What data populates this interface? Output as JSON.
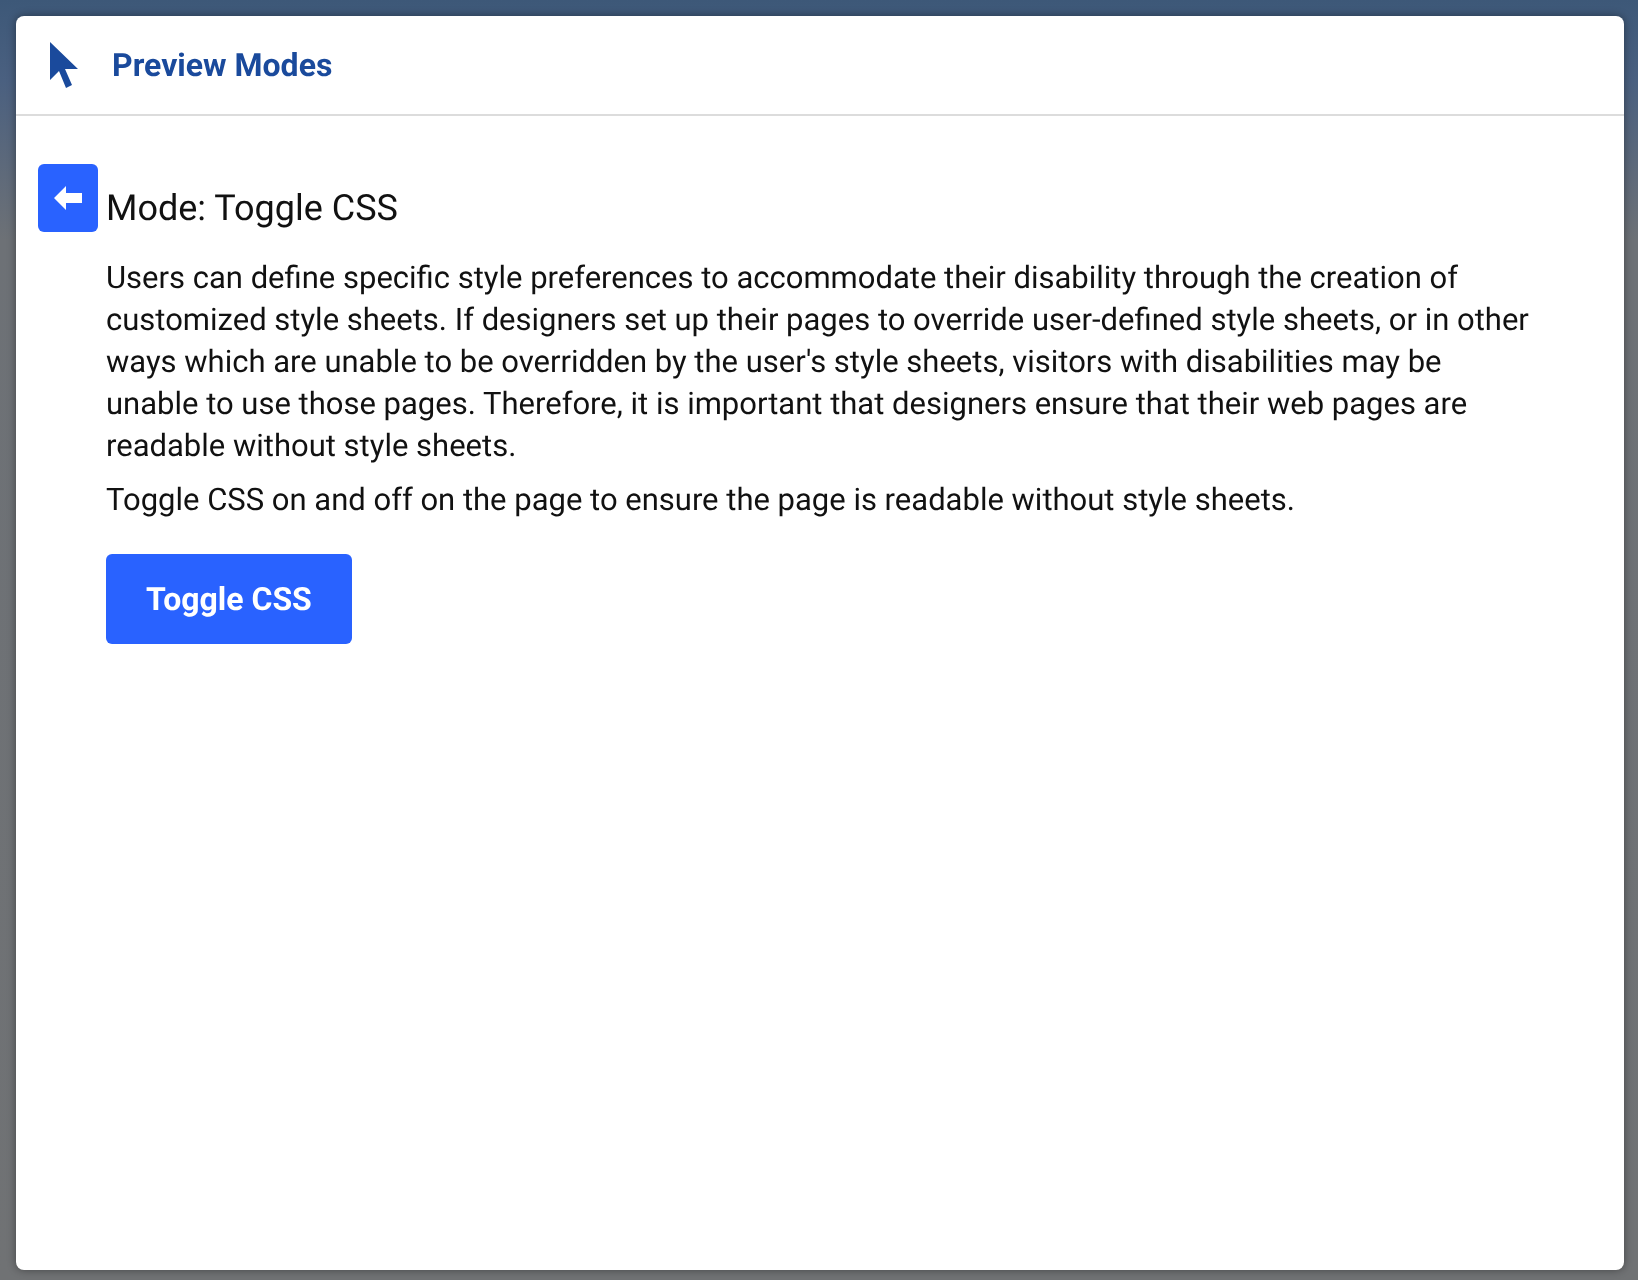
{
  "dialog": {
    "title": "Preview Modes"
  },
  "mode": {
    "title": "Mode: Toggle CSS",
    "paragraphs": [
      "Users can define specific style preferences to accommodate their disability through the creation of customized style sheets. If designers set up their pages to override user-defined style sheets, or in other ways which are unable to be overridden by the user's style sheets, visitors with disabilities may be unable to use those pages. Therefore, it is important that designers ensure that their web pages are readable without style sheets.",
      "Toggle CSS on and off on the page to ensure the page is readable without style sheets."
    ],
    "button": "Toggle CSS"
  }
}
